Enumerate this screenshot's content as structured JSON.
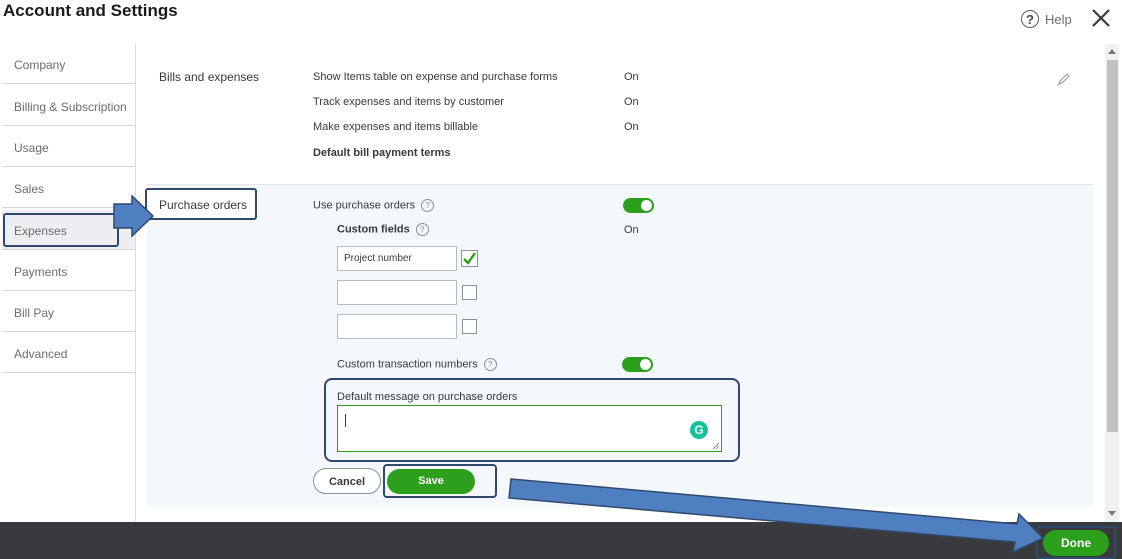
{
  "header": {
    "title": "Account and Settings",
    "help_label": "Help",
    "help_icon_glyph": "?"
  },
  "sidebar": {
    "items": [
      {
        "label": "Company"
      },
      {
        "label": "Billing & Subscription"
      },
      {
        "label": "Usage"
      },
      {
        "label": "Sales"
      },
      {
        "label": "Expenses",
        "active": true
      },
      {
        "label": "Payments"
      },
      {
        "label": "Bill Pay"
      },
      {
        "label": "Advanced"
      }
    ]
  },
  "bills": {
    "section_label": "Bills and expenses",
    "rows": [
      {
        "label": "Show Items table on expense and purchase forms",
        "value": "On"
      },
      {
        "label": "Track expenses and items by customer",
        "value": "On"
      },
      {
        "label": "Make expenses and items billable",
        "value": "On"
      },
      {
        "label": "Default bill payment terms",
        "value": ""
      }
    ]
  },
  "purchase_orders": {
    "section_label": "Purchase orders",
    "use_label": "Use purchase orders",
    "use_enabled": true,
    "custom_fields_label": "Custom fields",
    "custom_fields_value": "On",
    "custom_fields": [
      {
        "value": "Project number",
        "checked": true
      },
      {
        "value": "",
        "checked": false
      },
      {
        "value": "",
        "checked": false
      }
    ],
    "custom_txn_label": "Custom transaction numbers",
    "custom_txn_enabled": true,
    "message_label": "Default message on purchase orders",
    "message_value": "",
    "grammarly_glyph": "G",
    "cancel_label": "Cancel",
    "save_label": "Save"
  },
  "footer": {
    "done_label": "Done"
  },
  "colors": {
    "accent": "#2ca01c",
    "annotation": "#4f7fc1",
    "annotation_border": "#2f4a6d",
    "footer_bg": "#393a3d"
  }
}
